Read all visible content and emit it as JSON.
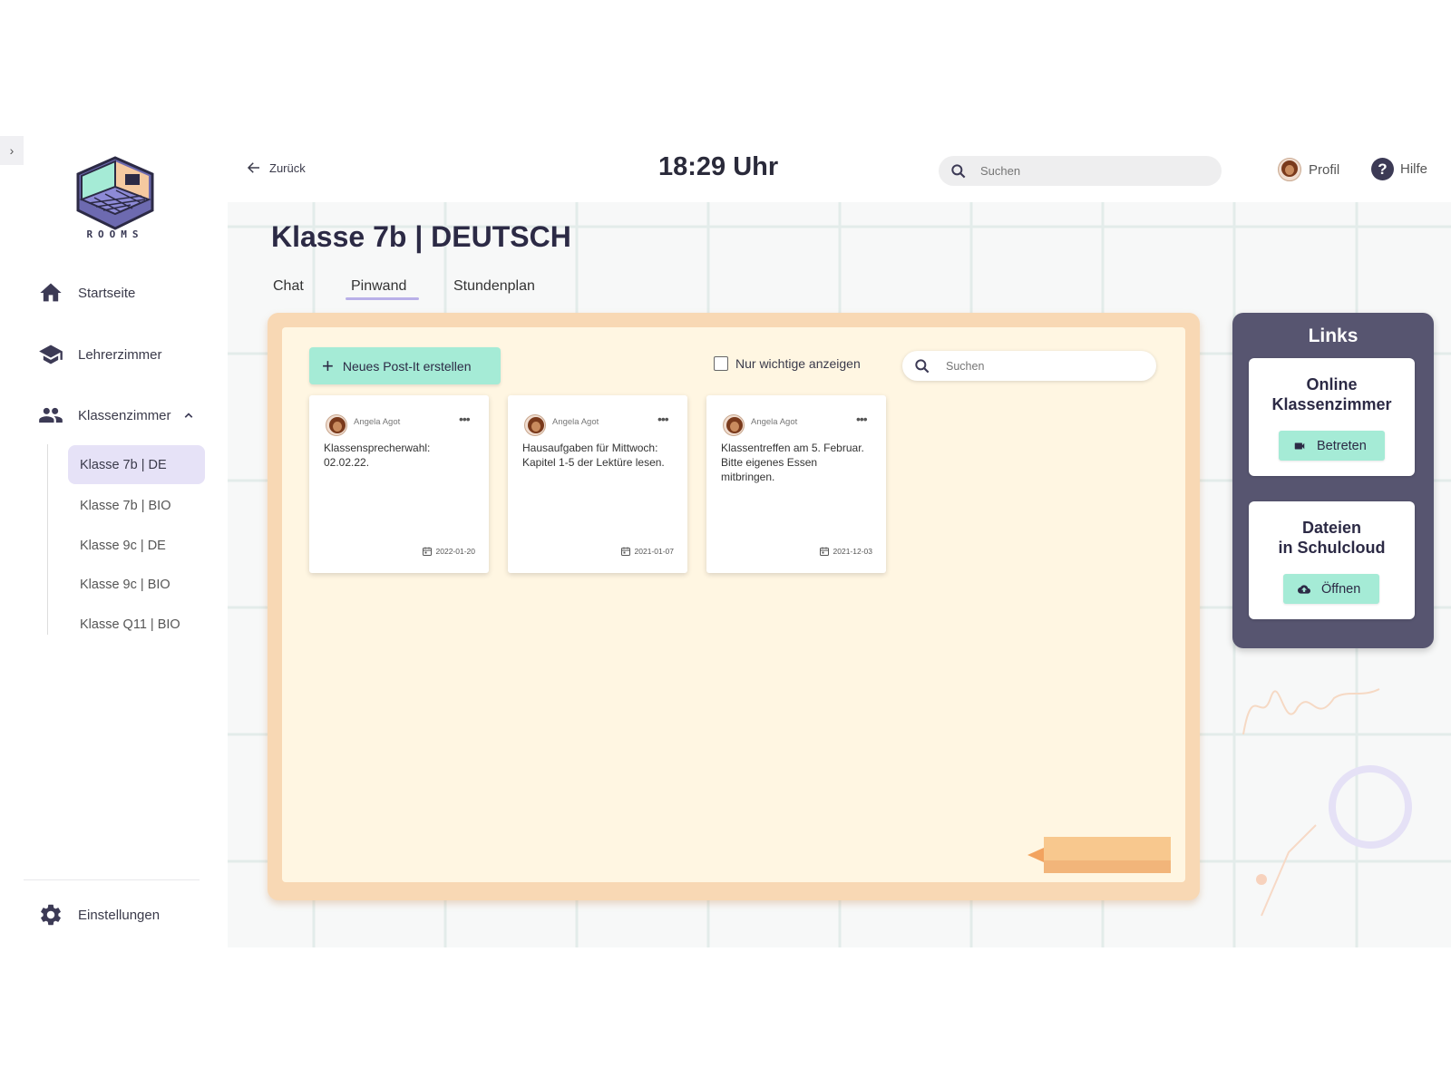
{
  "sidebar": {
    "logo_text": "ROOMS",
    "nav": {
      "home": "Startseite",
      "teachers": "Lehrerzimmer",
      "classrooms": "Klassenzimmer"
    },
    "classes": [
      "Klasse 7b | DE",
      "Klasse 7b | BIO",
      "Klasse 9c | DE",
      "Klasse 9c | BIO",
      "Klasse Q11 | BIO"
    ],
    "settings": "Einstellungen"
  },
  "topbar": {
    "back": "Zurück",
    "clock": "18:29 Uhr",
    "search_placeholder": "Suchen",
    "profile": "Profil",
    "help": "Hilfe"
  },
  "page": {
    "title": "Klasse 7b | DEUTSCH",
    "tabs": [
      "Chat",
      "Pinwand",
      "Stundenplan"
    ],
    "active_tab": "Pinwand"
  },
  "board": {
    "new_button": "Neues Post-It erstellen",
    "filter_label": "Nur wichtige anzeigen",
    "search_placeholder": "Suchen",
    "postits": [
      {
        "author": "Angela Agot",
        "text": "Klassensprecherwahl: 02.02.22.",
        "date": "2022-01-20"
      },
      {
        "author": "Angela Agot",
        "text": "Hausaufgaben für Mittwoch: Kapitel 1-5 der Lektüre lesen.",
        "date": "2021-01-07"
      },
      {
        "author": "Angela Agot",
        "text": "Klassentreffen am 5. Februar. Bitte eigenes Essen mitbringen.",
        "date": "2021-12-03"
      }
    ]
  },
  "links": {
    "title": "Links",
    "online": {
      "title_line1": "Online",
      "title_line2": "Klassenzimmer",
      "button": "Betreten"
    },
    "files": {
      "title_line1": "Dateien",
      "title_line2": "in Schulcloud",
      "button": "Öffnen"
    }
  },
  "colors": {
    "accent_green": "#a5ebd6",
    "active_lavender": "#e6e2f7",
    "board_frame": "#f8d8b4",
    "links_panel": "#575570"
  }
}
